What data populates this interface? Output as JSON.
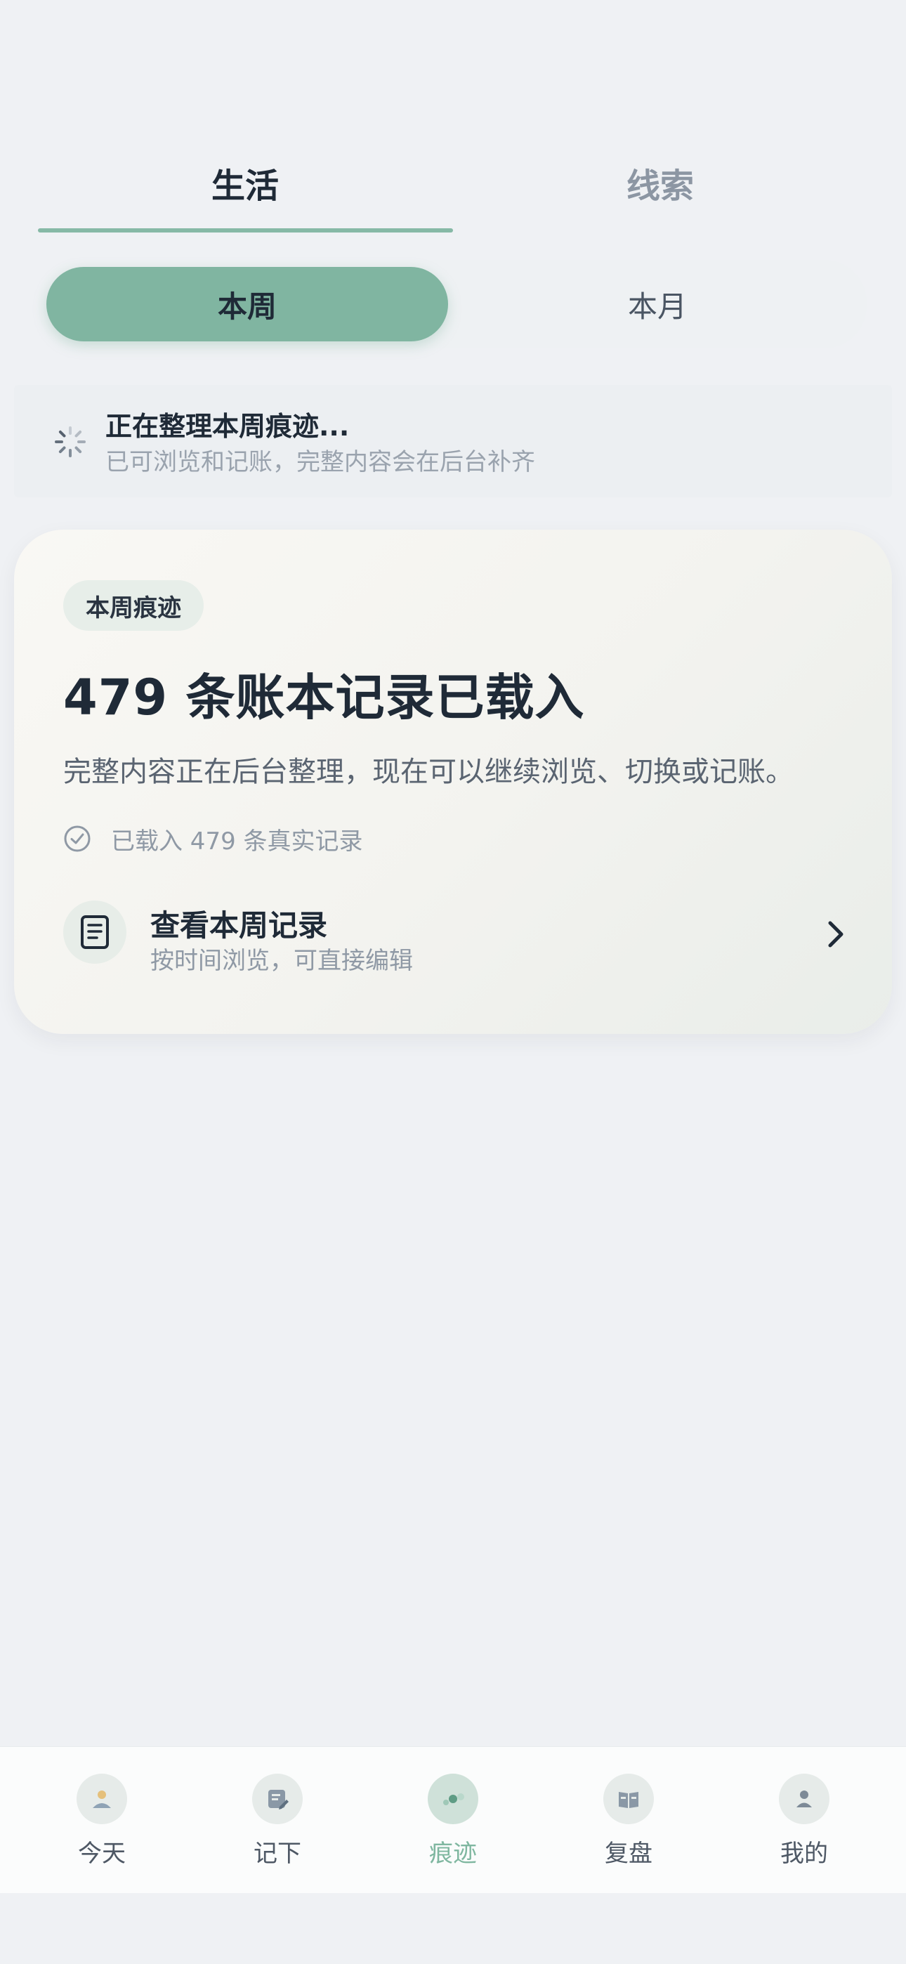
{
  "top_tabs": {
    "items": [
      {
        "label": "生活",
        "active": true
      },
      {
        "label": "线索",
        "active": false
      }
    ]
  },
  "segment": {
    "items": [
      {
        "label": "本周",
        "active": true
      },
      {
        "label": "本月",
        "active": false
      }
    ]
  },
  "notice": {
    "title": "正在整理本周痕迹...",
    "subtitle": "已可浏览和记账，完整内容会在后台补齐"
  },
  "card": {
    "badge": "本周痕迹",
    "title": "479 条账本记录已载入",
    "description": "完整内容正在后台整理，现在可以继续浏览、切换或记账。",
    "status": "已载入 479 条真实记录",
    "link": {
      "title": "查看本周记录",
      "subtitle": "按时间浏览，可直接编辑"
    }
  },
  "bottom_nav": {
    "items": [
      {
        "label": "今天",
        "icon": "person-sun-icon",
        "active": false
      },
      {
        "label": "记下",
        "icon": "note-edit-icon",
        "active": false
      },
      {
        "label": "痕迹",
        "icon": "trace-dots-icon",
        "active": true
      },
      {
        "label": "复盘",
        "icon": "book-icon",
        "active": false
      },
      {
        "label": "我的",
        "icon": "profile-icon",
        "active": false
      }
    ]
  },
  "colors": {
    "accent": "#80b5a1",
    "background": "#eff1f4",
    "text": "#1f2a37",
    "muted": "#8f99a5"
  }
}
